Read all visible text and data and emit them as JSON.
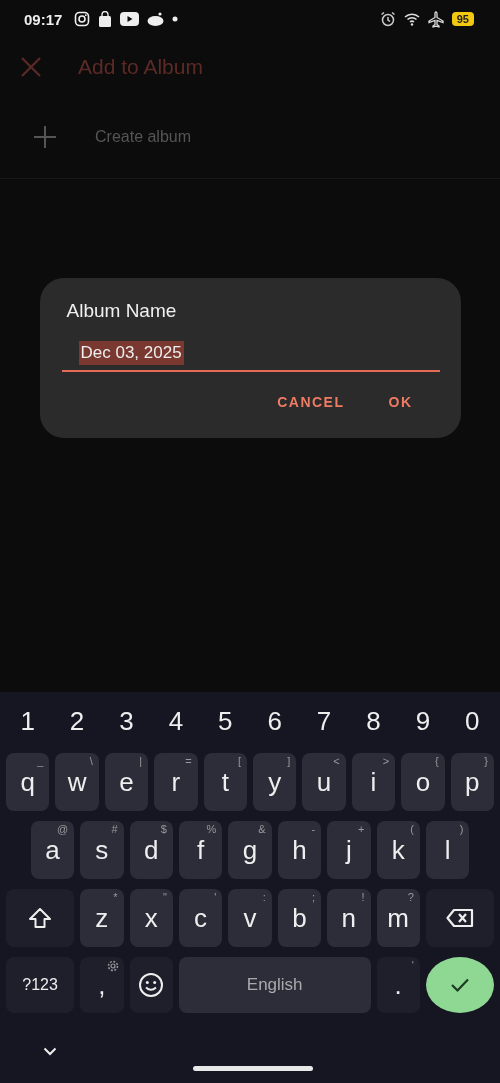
{
  "status_bar": {
    "time": "09:17",
    "battery": "95"
  },
  "app_bar": {
    "title": "Add to Album"
  },
  "list": {
    "create_label": "Create album"
  },
  "dialog": {
    "title": "Album Name",
    "field": {
      "value": "Dec 03, 2025",
      "text_selected": true
    },
    "buttons": [
      "CANCEL",
      "OK"
    ]
  },
  "keyboard": {
    "number_row": [
      "1",
      "2",
      "3",
      "4",
      "5",
      "6",
      "7",
      "8",
      "9",
      "0"
    ],
    "top_row": {
      "keys": [
        {
          "kind": "char",
          "label": "q",
          "hint": "_"
        },
        {
          "kind": "char",
          "label": "w",
          "hint": "\\"
        },
        {
          "kind": "char",
          "label": "e",
          "hint": "|"
        },
        {
          "kind": "char",
          "label": "r",
          "hint": "="
        },
        {
          "kind": "char",
          "label": "t",
          "hint": "["
        },
        {
          "kind": "char",
          "label": "y",
          "hint": "]"
        },
        {
          "kind": "char",
          "label": "u",
          "hint": "<"
        },
        {
          "kind": "char",
          "label": "i",
          "hint": ">"
        },
        {
          "kind": "char",
          "label": "o",
          "hint": "{"
        },
        {
          "kind": "char",
          "label": "p",
          "hint": "}"
        }
      ]
    },
    "home_row": {
      "keys": [
        {
          "kind": "char",
          "label": "a",
          "hint": "@"
        },
        {
          "kind": "char",
          "label": "s",
          "hint": "#"
        },
        {
          "kind": "char",
          "label": "d",
          "hint": "$"
        },
        {
          "kind": "char",
          "label": "f",
          "hint": "%"
        },
        {
          "kind": "char",
          "label": "g",
          "hint": "&"
        },
        {
          "kind": "char",
          "label": "h",
          "hint": "-"
        },
        {
          "kind": "char",
          "label": "j",
          "hint": "+"
        },
        {
          "kind": "char",
          "label": "k",
          "hint": "("
        },
        {
          "kind": "char",
          "label": "l",
          "hint": ")"
        }
      ]
    },
    "bottom_row": {
      "keys": [
        {
          "kind": "shift"
        },
        {
          "kind": "char",
          "label": "z",
          "hint": "*"
        },
        {
          "kind": "char",
          "label": "x",
          "hint": "\""
        },
        {
          "kind": "char",
          "label": "c",
          "hint": "'"
        },
        {
          "kind": "char",
          "label": "v",
          "hint": ":"
        },
        {
          "kind": "char",
          "label": "b",
          "hint": ";"
        },
        {
          "kind": "char",
          "label": "n",
          "hint": "!"
        },
        {
          "kind": "char",
          "label": "m",
          "hint": "?"
        },
        {
          "kind": "backspace"
        }
      ]
    },
    "space_row": {
      "keys": [
        {
          "kind": "symbols",
          "label": "?123"
        },
        {
          "kind": "comma",
          "label": ","
        },
        {
          "kind": "emoji"
        },
        {
          "kind": "space",
          "label": "English"
        },
        {
          "kind": "char",
          "label": ".",
          "hint": "'"
        },
        {
          "kind": "enter"
        }
      ]
    }
  }
}
